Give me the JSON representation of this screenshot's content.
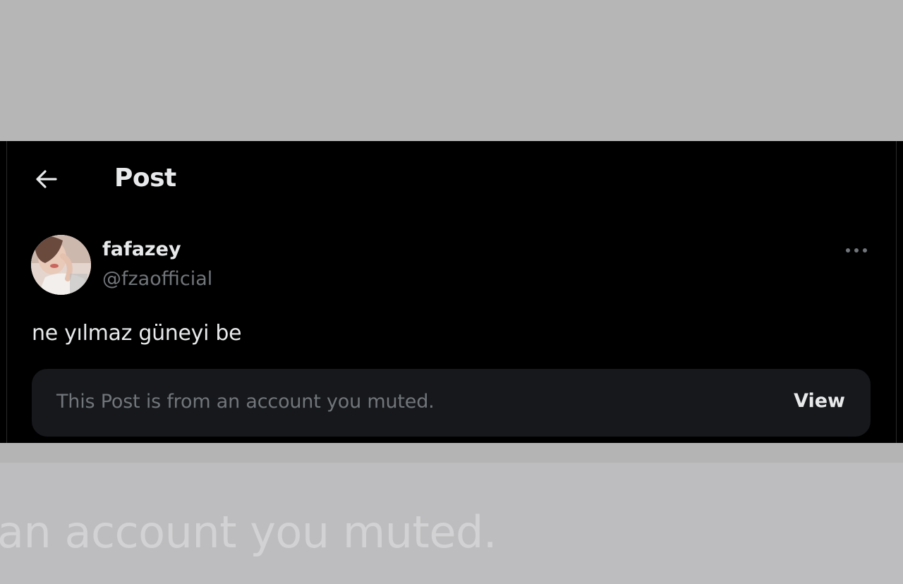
{
  "header": {
    "back_icon": "arrow-left-icon",
    "title": "Post"
  },
  "post": {
    "avatar_icon": "profile-photo",
    "display_name": "fafazey",
    "handle": "@fzaofficial",
    "more_icon": "more-horizontal-icon",
    "text": "ne yılmaz güneyi be",
    "muted_notice": {
      "message": "This Post is from an account you muted.",
      "view_label": "View"
    }
  },
  "zoom_caption": {
    "text": "an account you muted."
  },
  "colors": {
    "background": "#000000",
    "primary_text": "#e7e9ea",
    "secondary_text": "#71767b",
    "card_background": "#16181c",
    "frame_gray": "#b7b7b7"
  }
}
